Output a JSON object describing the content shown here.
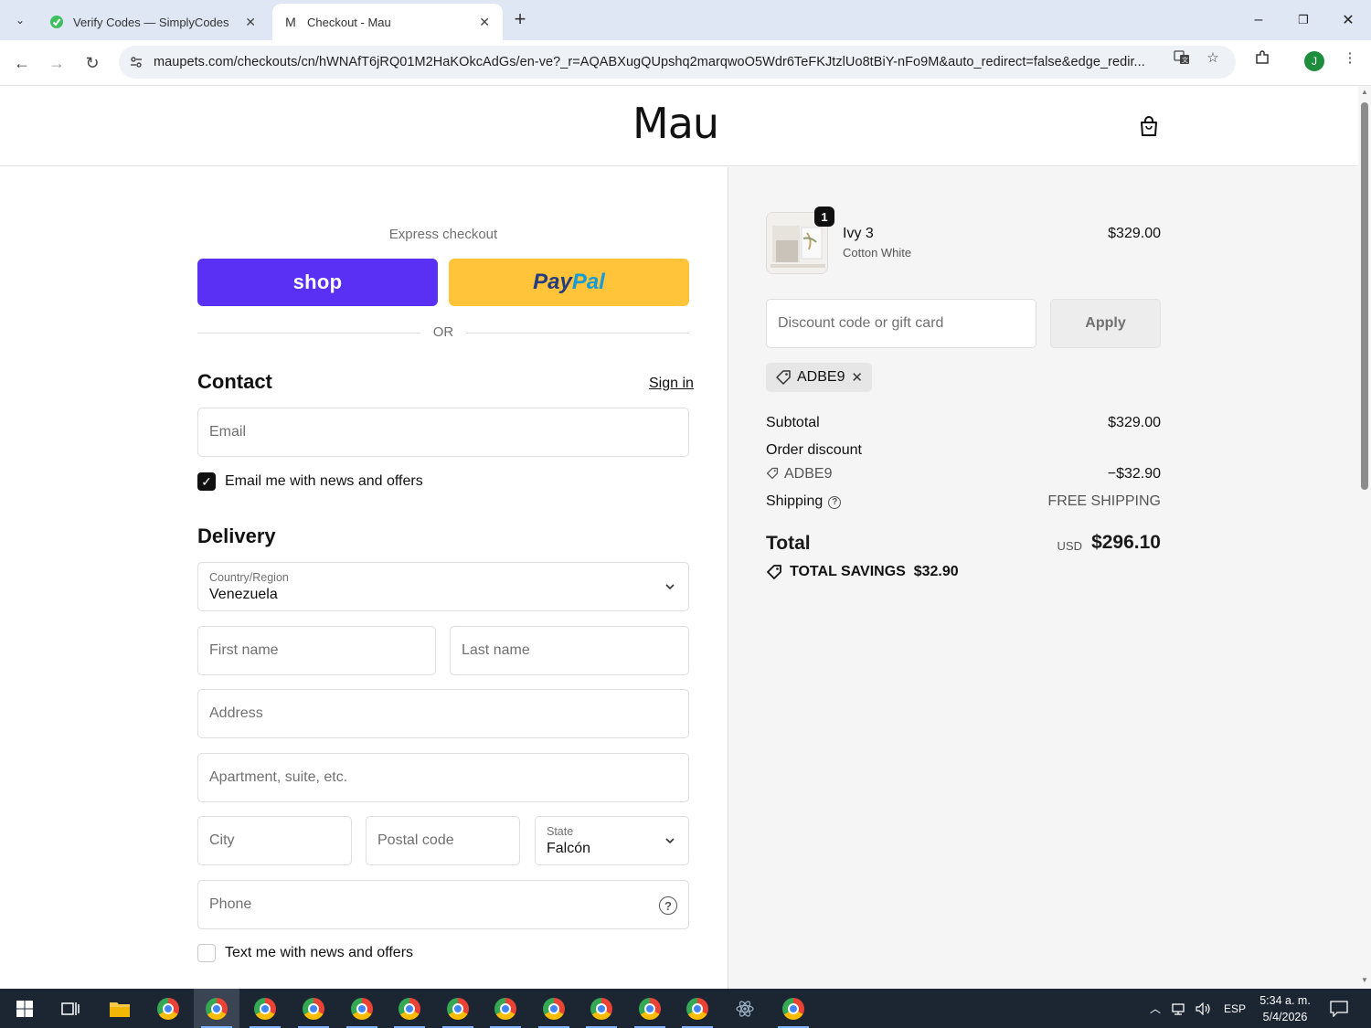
{
  "browser": {
    "tabs": [
      {
        "title": "Verify Codes — SimplyCodes",
        "active": false
      },
      {
        "title": "Checkout - Mau",
        "active": true
      }
    ],
    "url": "maupets.com/checkouts/cn/hWNAfT6jRQ01M2HaKOkcAdGs/en-ve?_r=AQABXugQUpshq2marqwoO5Wdr6TeFKJtzlUo8tBiY-nFo9M&auto_redirect=false&edge_redir...",
    "profile_initial": "J",
    "colors": {
      "tabbar": "#dfe7f4",
      "profile": "#1e8e3e"
    }
  },
  "header": {
    "logo": "Mau"
  },
  "express": {
    "label": "Express checkout",
    "shop_label": "shop",
    "paypal_label_1": "Pay",
    "paypal_label_2": "Pal",
    "or_label": "OR",
    "colors": {
      "shop": "#5a31f4",
      "paypal": "#ffc439"
    }
  },
  "contact": {
    "title": "Contact",
    "signin": "Sign in",
    "email_placeholder": "Email",
    "email_news_label": "Email me with news and offers",
    "email_news_checked": true
  },
  "delivery": {
    "title": "Delivery",
    "country_label": "Country/Region",
    "country_value": "Venezuela",
    "first_name": "First name",
    "last_name": "Last name",
    "address": "Address",
    "apartment": "Apartment, suite, etc.",
    "city": "City",
    "postal": "Postal code",
    "state_label": "State",
    "state_value": "Falcón",
    "phone": "Phone",
    "text_news_label": "Text me with news and offers",
    "text_news_checked": false
  },
  "summary": {
    "product": {
      "quantity": "1",
      "name": "Ivy 3",
      "variant": "Cotton White",
      "price": "$329.00"
    },
    "discount_placeholder": "Discount code or gift card",
    "apply_label": "Apply",
    "applied_code": "ADBE9",
    "subtotal_label": "Subtotal",
    "subtotal_value": "$329.00",
    "order_discount_label": "Order discount",
    "discount_code": "ADBE9",
    "discount_value": "−$32.90",
    "shipping_label": "Shipping",
    "shipping_value": "FREE SHIPPING",
    "total_label": "Total",
    "total_currency": "USD",
    "total_value": "$296.10",
    "savings_label": "TOTAL SAVINGS",
    "savings_value": "$32.90"
  },
  "taskbar": {
    "language": "ESP",
    "time": "5:34 a. m.",
    "date": "5/4/2026"
  }
}
